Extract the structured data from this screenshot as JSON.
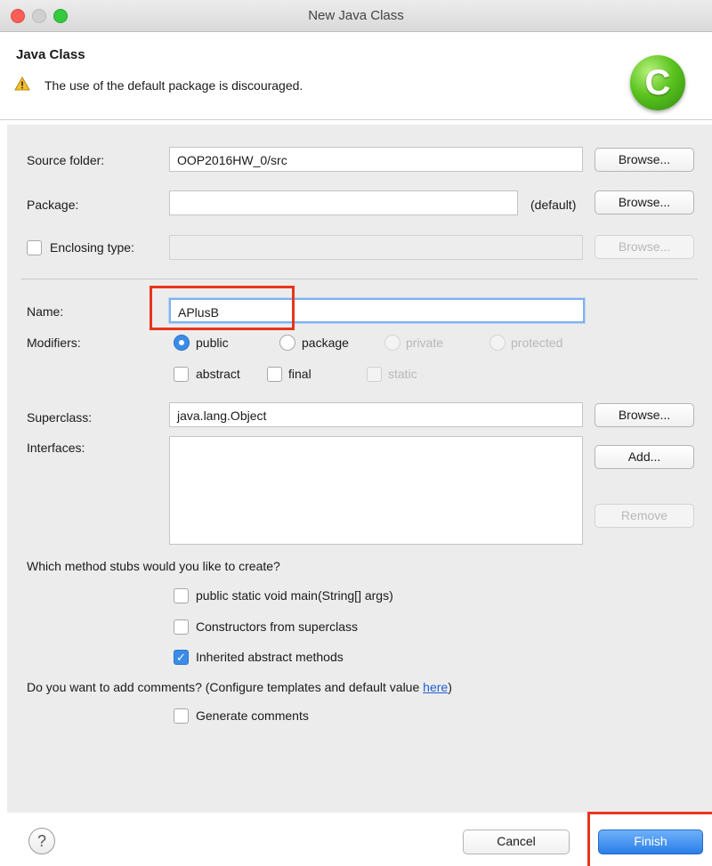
{
  "window": {
    "title": "New Java Class"
  },
  "header": {
    "title": "Java Class",
    "message": "The use of the default package is discouraged.",
    "logo_letter": "C"
  },
  "form": {
    "source_folder": {
      "label": "Source folder:",
      "value": "OOP2016HW_0/src",
      "button": "Browse..."
    },
    "package": {
      "label": "Package:",
      "value": "",
      "suffix": "(default)",
      "button": "Browse..."
    },
    "enclosing_type": {
      "label": "Enclosing type:",
      "value": "",
      "button": "Browse...",
      "checked": false
    },
    "name": {
      "label": "Name:",
      "value": "APlusB"
    },
    "modifiers": {
      "label": "Modifiers:",
      "access": [
        "public",
        "package",
        "private",
        "protected"
      ],
      "selected": "public",
      "flags": [
        "abstract",
        "final",
        "static"
      ]
    },
    "superclass": {
      "label": "Superclass:",
      "value": "java.lang.Object",
      "button": "Browse..."
    },
    "interfaces": {
      "label": "Interfaces:",
      "add_button": "Add...",
      "remove_button": "Remove"
    },
    "stubs": {
      "question": "Which method stubs would you like to create?",
      "options": [
        "public static void main(String[] args)",
        "Constructors from superclass",
        "Inherited abstract methods"
      ],
      "checked": [
        false,
        false,
        true
      ]
    },
    "comments": {
      "question": "Do you want to add comments? (Configure templates and default value ",
      "link": "here",
      "question_end": ")",
      "option": "Generate comments",
      "checked": false
    }
  },
  "footer": {
    "help": "?",
    "cancel": "Cancel",
    "finish": "Finish"
  },
  "colors": {
    "accent": "#3b8ce6",
    "highlight": "#e8351d",
    "logo": "#5bc41f"
  }
}
